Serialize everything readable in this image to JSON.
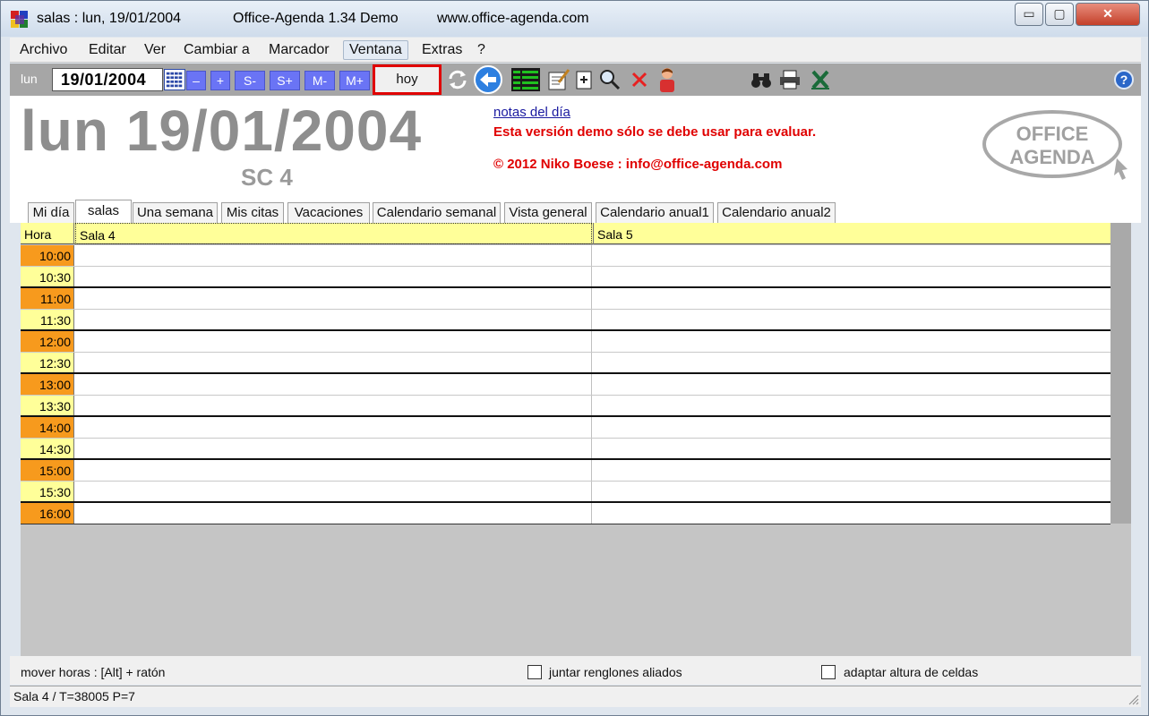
{
  "window": {
    "title_left": "salas : lun, 19/01/2004",
    "title_mid": "Office-Agenda 1.34 Demo",
    "title_url": "www.office-agenda.com",
    "minimize": "▭",
    "maximize": "▢",
    "close": "✕"
  },
  "menu": [
    {
      "label": "Archivo"
    },
    {
      "label": "Editar"
    },
    {
      "label": "Ver"
    },
    {
      "label": "Cambiar a"
    },
    {
      "label": "Marcador"
    },
    {
      "label": "Ventana"
    },
    {
      "label": "Extras"
    },
    {
      "label": "?"
    }
  ],
  "toolbar": {
    "day_label": "lun",
    "date_value": "19/01/2004",
    "minus": "–",
    "plus": "+",
    "week_minus": "S-",
    "week_plus": "S+",
    "month_minus": "M-",
    "month_plus": "M+",
    "today": "hoy",
    "help": "?"
  },
  "header": {
    "big_date": "lun 19/01/2004",
    "room_code": "SC 4",
    "notes_link": "notas del día",
    "demo_warning": "Esta versión demo sólo se debe usar para evaluar.",
    "copyright": "© 2012 Niko Boese : info@office-agenda.com",
    "logo_line1": "OFFICE",
    "logo_line2": "AGENDA"
  },
  "tabs": [
    {
      "label": "Mi día"
    },
    {
      "label": "salas"
    },
    {
      "label": "Una semana"
    },
    {
      "label": "Mis citas"
    },
    {
      "label": "Vacaciones"
    },
    {
      "label": "Calendario semanal"
    },
    {
      "label": "Vista general"
    },
    {
      "label": "Calendario anual1"
    },
    {
      "label": "Calendario anual2"
    }
  ],
  "grid": {
    "hour_header": "Hora",
    "rooms": [
      "Sala 4",
      "Sala 5"
    ],
    "times": [
      "10:00",
      "10:30",
      "11:00",
      "11:30",
      "12:00",
      "12:30",
      "13:00",
      "13:30",
      "14:00",
      "14:30",
      "15:00",
      "15:30",
      "16:00"
    ]
  },
  "options": {
    "hint": "mover horas : [Alt] + ratón",
    "join_rows": "juntar renglones aliados",
    "adapt_height": "adaptar altura de celdas"
  },
  "status": {
    "text": "Sala 4 / T=38005  P=7"
  },
  "colors": {
    "full_hour": "#f79a1d",
    "half_hour": "#ffff99",
    "header_yellow": "#ffff99",
    "demo_red": "#e00000",
    "nav_blue": "#6a74f5"
  }
}
